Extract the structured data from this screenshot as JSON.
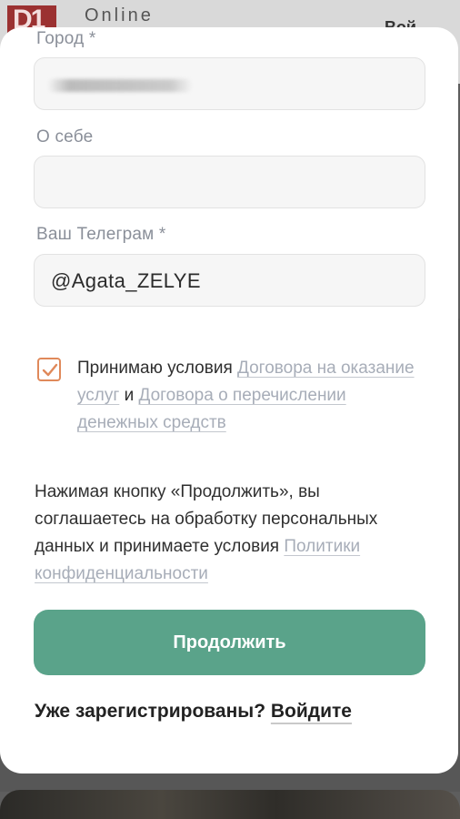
{
  "background": {
    "logo_text": "D1",
    "brand_text": "Online",
    "header_right_text": "Вой"
  },
  "form": {
    "city": {
      "label": "Город *",
      "value_hidden": true
    },
    "about": {
      "label": "О себе",
      "value": ""
    },
    "telegram": {
      "label": "Ваш Телеграм *",
      "value": "@Agata_ZELYE"
    },
    "terms": {
      "checked": true,
      "prefix": "Принимаю условия ",
      "link1": "Договора на оказание услуг",
      "middle": " и ",
      "link2": "Договора о перечислении денежных средств"
    },
    "notice": {
      "text": "Нажимая кнопку «Продолжить», вы соглашаетесь на обработку персональных данных и принимаете условия ",
      "link": "Политики конфиденциальности"
    },
    "continue_label": "Продолжить",
    "login": {
      "question": "Уже зарегистрированы?",
      "link": "Войдите"
    }
  },
  "colors": {
    "accent_button": "#5aa38a",
    "checkbox_border": "#e0895a",
    "link": "#a7adb8"
  }
}
